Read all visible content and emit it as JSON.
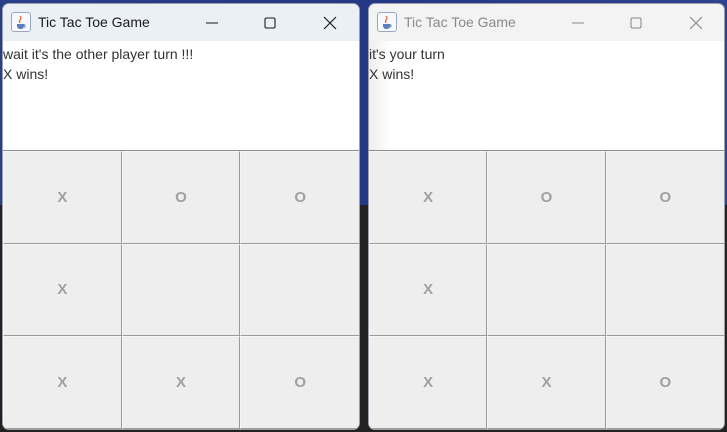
{
  "windows": [
    {
      "title": "Tic Tac Toe Game",
      "status_lines": [
        "wait it's the other player turn !!!",
        "X wins!"
      ],
      "board": [
        "X",
        "O",
        "O",
        "X",
        "",
        "",
        "X",
        "X",
        "O"
      ]
    },
    {
      "title": "Tic Tac Toe Game",
      "status_lines": [
        "it's your turn",
        "X wins!"
      ],
      "board": [
        "X",
        "O",
        "O",
        "X",
        "",
        "",
        "X",
        "X",
        "O"
      ]
    }
  ],
  "colors": {
    "mark": "#a0a0a0",
    "board_bg": "#eeeeee",
    "titlebar_active": "#eaf0f6",
    "titlebar_inactive": "#f3f3f3"
  },
  "icons": {
    "app": "java-icon",
    "minimize": "minimize-icon",
    "maximize": "maximize-icon",
    "close": "close-icon"
  }
}
